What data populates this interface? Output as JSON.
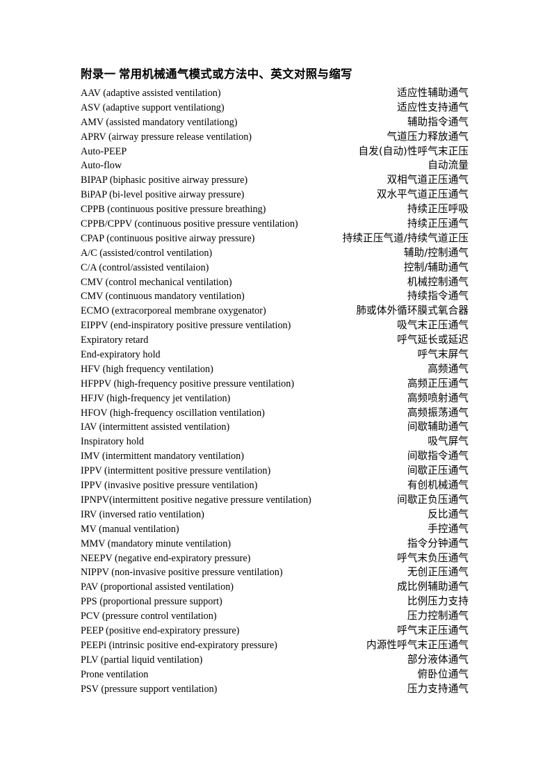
{
  "document": {
    "title": "附录一 常用机械通气模式或方法中、英文对照与缩写",
    "page_background": "#ffffff",
    "text_color": "#000000"
  },
  "entries": [
    {
      "en": "AAV (adaptive assisted ventilation)",
      "zh": "适应性辅助通气"
    },
    {
      "en": "ASV (adaptive support ventilationg)",
      "zh": "适应性支持通气"
    },
    {
      "en": "AMV (assisted mandatory ventilationg)",
      "zh": "辅助指令通气"
    },
    {
      "en": "APRV (airway pressure release ventilation)",
      "zh": "气道压力释放通气"
    },
    {
      "en": "Auto-PEEP",
      "zh": "自发(自动)性呼气末正压"
    },
    {
      "en": "Auto-flow",
      "zh": "自动流量"
    },
    {
      "en": "BIPAP (biphasic positive airway pressure)",
      "zh": "双相气道正压通气"
    },
    {
      "en": "BiPAP (bi-level positive airway pressure)",
      "zh": "双水平气道正压通气"
    },
    {
      "en": "CPPB (continuous positive pressure breathing)",
      "zh": "持续正压呼吸"
    },
    {
      "en": "CPPB/CPPV (continuous positive pressure ventilation)",
      "zh": "持续正压通气"
    },
    {
      "en": "CPAP (continuous positive airway pressure)",
      "zh": "持续正压气道/持续气道正压"
    },
    {
      "en": "A/C (assisted/control ventilation)",
      "zh": "辅助/控制通气"
    },
    {
      "en": "C/A (control/assisted ventilaion)",
      "zh": "控制/辅助通气"
    },
    {
      "en": "CMV (control mechanical ventilation)",
      "zh": "机械控制通气"
    },
    {
      "en": "CMV (continuous mandatory ventilation)",
      "zh": "持续指令通气"
    },
    {
      "en": "ECMO (extracorporeal membrane oxygenator)",
      "zh": "肺或体外循环膜式氧合器"
    },
    {
      "en": "EIPPV (end-inspiratory positive pressure ventilation)",
      "zh": "吸气末正压通气"
    },
    {
      "en": "Expiratory retard",
      "zh": "呼气延长或延迟"
    },
    {
      "en": "End-expiratory hold",
      "zh": "呼气末屏气"
    },
    {
      "en": "HFV (high frequency ventilation)",
      "zh": "高频通气"
    },
    {
      "en": "HFPPV (high-frequency positive pressure ventilation)",
      "zh": "高频正压通气"
    },
    {
      "en": "HFJV (high-frequency jet ventilation)",
      "zh": "高频喷射通气"
    },
    {
      "en": "HFOV (high-frequency oscillation ventilation)",
      "zh": "高频振荡通气"
    },
    {
      "en": "IAV (intermittent assisted ventilation)",
      "zh": "间歇辅助通气"
    },
    {
      "en": "Inspiratory hold",
      "zh": "吸气屏气"
    },
    {
      "en": "IMV (intermittent mandatory ventilation)",
      "zh": "间歇指令通气"
    },
    {
      "en": "IPPV (intermittent positive pressure ventilation)",
      "zh": "间歇正压通气"
    },
    {
      "en": "IPPV (invasive positive pressure ventilation)",
      "zh": "有创机械通气"
    },
    {
      "en": "IPNPV(intermittent positive negative pressure ventilation)",
      "zh": "间歇正负压通气"
    },
    {
      "en": "IRV (inversed ratio ventilation)",
      "zh": "反比通气"
    },
    {
      "en": "MV (manual ventilation)",
      "zh": "手控通气"
    },
    {
      "en": "MMV (mandatory minute ventilation)",
      "zh": "指令分钟通气"
    },
    {
      "en": "NEEPV (negative end-expiratory pressure)",
      "zh": "呼气末负压通气"
    },
    {
      "en": "NIPPV (non-invasive positive pressure ventilation)",
      "zh": "无创正压通气"
    },
    {
      "en": "PAV (proportional assisted ventilation)",
      "zh": "成比例辅助通气"
    },
    {
      "en": "PPS (proportional pressure support)",
      "zh": "比例压力支持"
    },
    {
      "en": "PCV (pressure control ventilation)",
      "zh": "压力控制通气"
    },
    {
      "en": "PEEP (positive end-expiratory pressure)",
      "zh": "呼气末正压通气"
    },
    {
      "en": "PEEPi (intrinsic positive end-expiratory pressure)",
      "zh": "内源性呼气末正压通气"
    },
    {
      "en": "PLV (partial liquid ventilation)",
      "zh": "部分液体通气"
    },
    {
      "en": "Prone ventilation",
      "zh": "俯卧位通气"
    },
    {
      "en": "PSV (pressure support ventilation)",
      "zh": "压力支持通气"
    }
  ]
}
